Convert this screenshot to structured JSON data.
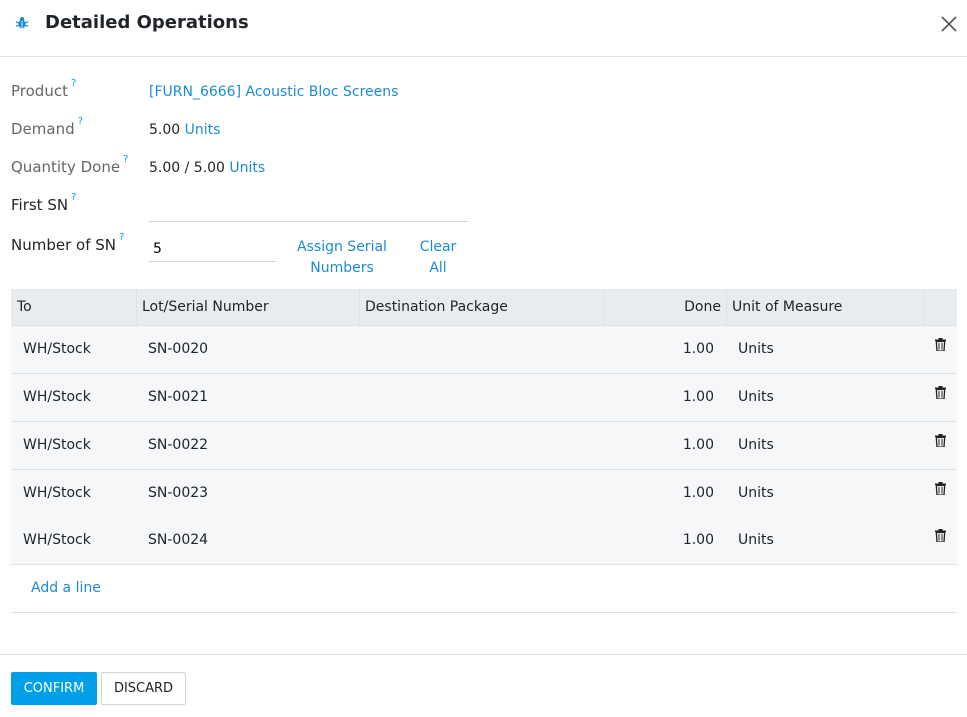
{
  "dialog": {
    "title": "Detailed Operations",
    "icon": "bug-icon",
    "accent_color": "#00a0e8",
    "link_color": "#1d8bd4"
  },
  "form": {
    "product_label": "Product",
    "product_value": "[FURN_6666] Acoustic Bloc Screens",
    "demand_label": "Demand",
    "demand_value": "5.00",
    "demand_uom": "Units",
    "qty_done_label": "Quantity Done",
    "qty_done_value": "5.00",
    "qty_done_sep": "/",
    "qty_done_total": "5.00",
    "qty_done_uom": "Units",
    "first_sn_label": "First SN",
    "first_sn_value": "",
    "num_sn_label": "Number of SN",
    "num_sn_value": "5",
    "help_mark": "?",
    "assign_line1": "Assign Serial",
    "assign_line2": "Numbers",
    "clear_line1": "Clear",
    "clear_line2": "All"
  },
  "table": {
    "headers": {
      "to": "To",
      "lot": "Lot/Serial Number",
      "dest": "Destination Package",
      "done": "Done",
      "uom": "Unit of Measure"
    },
    "rows": [
      {
        "to": "WH/Stock",
        "lot": "SN-0020",
        "dest": "",
        "done": "1.00",
        "uom": "Units"
      },
      {
        "to": "WH/Stock",
        "lot": "SN-0021",
        "dest": "",
        "done": "1.00",
        "uom": "Units"
      },
      {
        "to": "WH/Stock",
        "lot": "SN-0022",
        "dest": "",
        "done": "1.00",
        "uom": "Units"
      },
      {
        "to": "WH/Stock",
        "lot": "SN-0023",
        "dest": "",
        "done": "1.00",
        "uom": "Units"
      },
      {
        "to": "WH/Stock",
        "lot": "SN-0024",
        "dest": "",
        "done": "1.00",
        "uom": "Units"
      }
    ],
    "add_line": "Add a line"
  },
  "footer": {
    "confirm_label": "CONFIRM",
    "discard_label": "DISCARD"
  }
}
